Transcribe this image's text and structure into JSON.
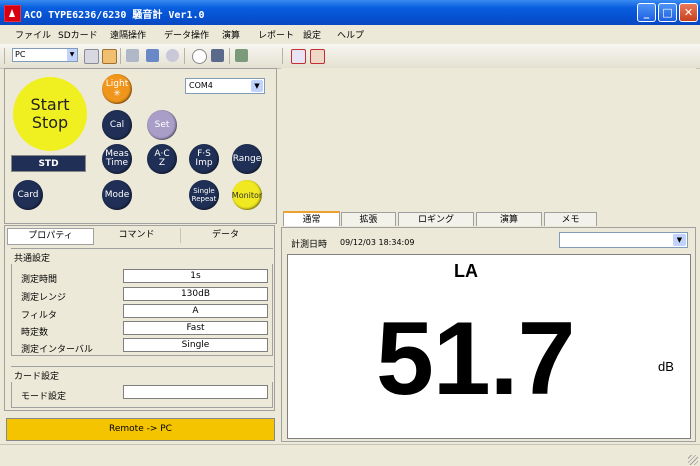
{
  "window": {
    "title": "ACO TYPE6236/6230 騒音計 Ver1.0"
  },
  "menu": [
    "ファイル",
    "SDカード",
    "遠隔操作",
    "データ操作",
    "演算",
    "レポート",
    "設定",
    "ヘルプ"
  ],
  "toolbar": {
    "device": "PC"
  },
  "control": {
    "start_stop_1": "Start",
    "start_stop_2": "Stop",
    "light_1": "Light",
    "light_2": "✳",
    "com_port": "COM4",
    "cal": "Cal",
    "set": "Set",
    "std": "STD",
    "meas_time_1": "Meas",
    "meas_time_2": "Time",
    "ac_z_1": "A·C",
    "ac_z_2": "Z",
    "fs_imp_1": "F·S",
    "fs_imp_2": "Imp",
    "range": "Range",
    "card": "Card",
    "mode": "Mode",
    "single_repeat_1": "Single",
    "single_repeat_2": "Repeat",
    "monitor": "Monitor"
  },
  "prop_tabs": [
    "プロパティ",
    "コマンド",
    "データ"
  ],
  "common_settings": {
    "label": "共通設定",
    "rows": [
      {
        "label": "測定時間",
        "value": "1s"
      },
      {
        "label": "測定レンジ",
        "value": "130dB"
      },
      {
        "label": "フィルタ",
        "value": "A"
      },
      {
        "label": "時定数",
        "value": "Fast"
      },
      {
        "label": "測定インターバル",
        "value": "Single"
      }
    ]
  },
  "card_settings": {
    "label": "カード設定",
    "rows": [
      {
        "label": "モード設定",
        "value": ""
      }
    ]
  },
  "remote_button": "Remote -> PC",
  "right_tabs": [
    "通常",
    "拡張",
    "ロギング",
    "演算",
    "メモ"
  ],
  "measurement": {
    "date_label": "計測日時",
    "date_value": "09/12/03 18:34:09",
    "weighting": "LA",
    "value": "51.7",
    "unit": "dB"
  }
}
